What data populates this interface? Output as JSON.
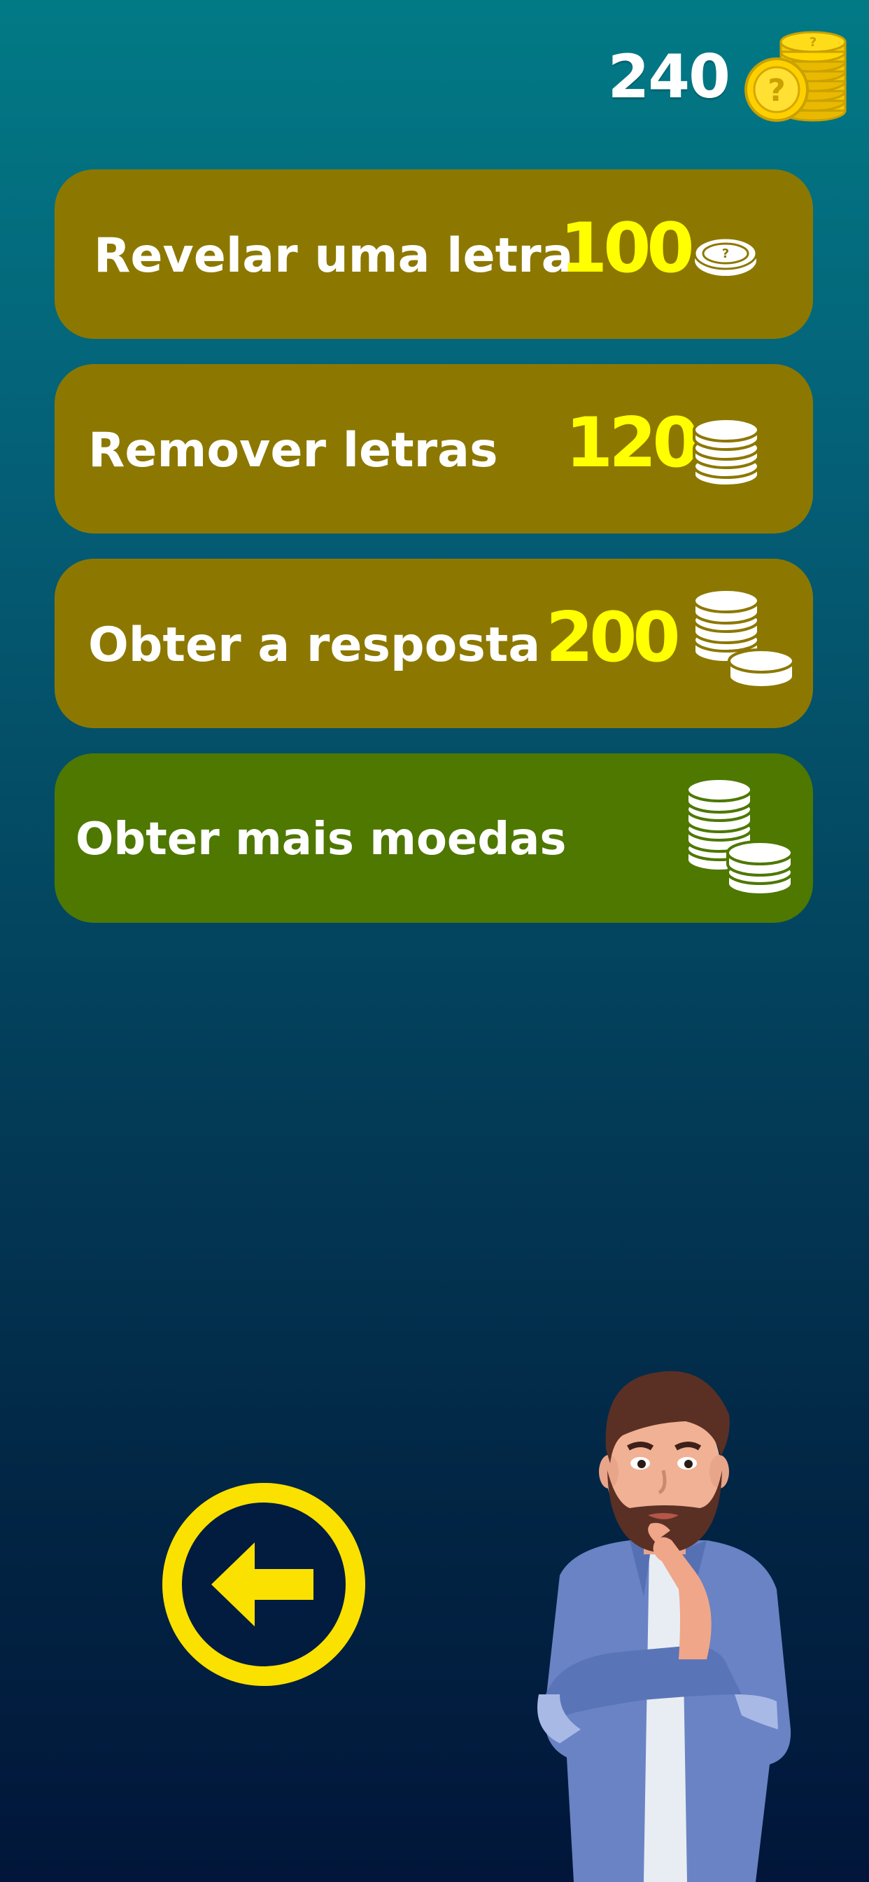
{
  "coins": {
    "count": "240",
    "icon": "gold-coin-stack-icon"
  },
  "options": [
    {
      "label": "Revelar uma letra",
      "price": "100",
      "icon": "single-coin-icon",
      "color": "#8c7800"
    },
    {
      "label": "Remover letras",
      "price": "120",
      "icon": "coin-stack-icon",
      "color": "#8c7800"
    },
    {
      "label": "Obter a resposta",
      "price": "200",
      "icon": "coin-stacks-icon",
      "color": "#8c7800"
    },
    {
      "label": "Obter mais moedas",
      "icon": "coin-stacks-icon",
      "color": "#4e7800"
    }
  ],
  "back": {
    "icon": "arrow-left-icon",
    "color": "#fbe100"
  },
  "character": {
    "icon": "thinking-man-illustration"
  },
  "colors": {
    "price": "#ffff00",
    "text": "#ffffff"
  }
}
